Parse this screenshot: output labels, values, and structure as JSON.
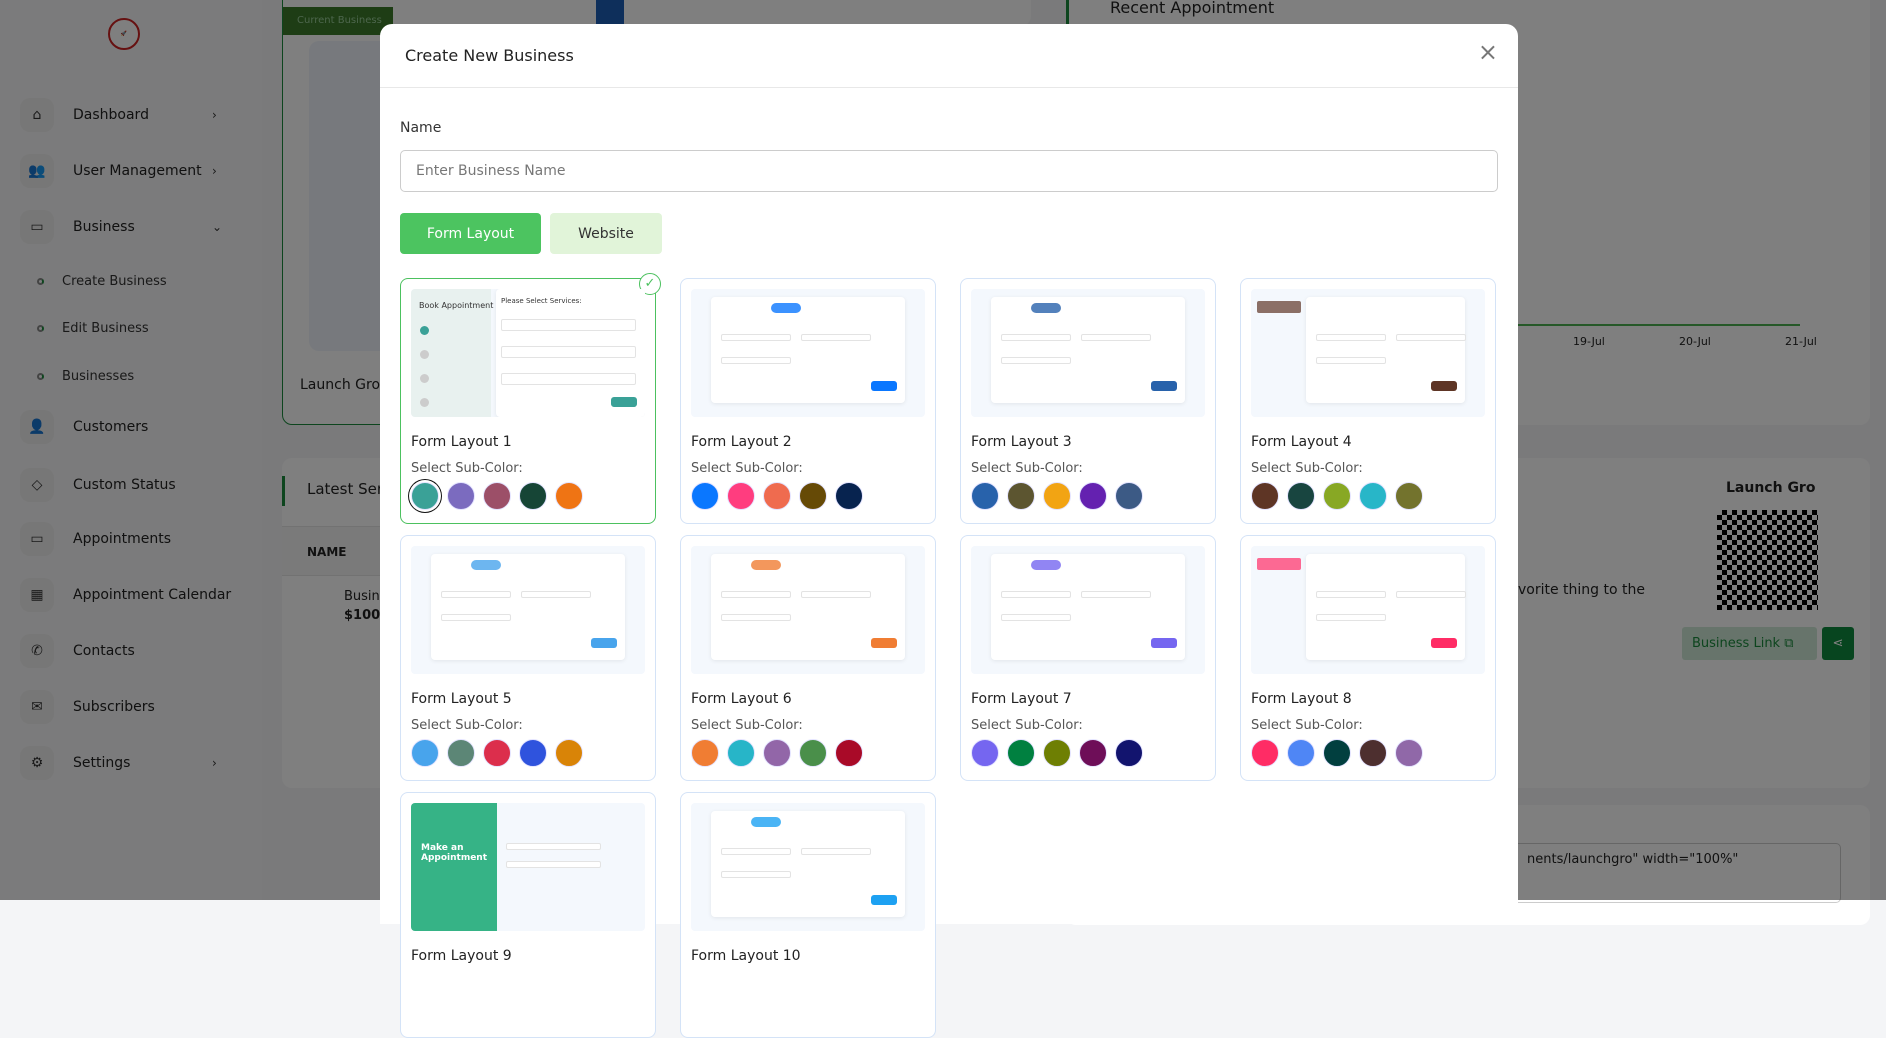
{
  "sidebar": {
    "logo": "LaunchGro",
    "items": [
      {
        "label": "Dashboard",
        "icon": "home-icon",
        "chev": "›"
      },
      {
        "label": "User Management",
        "icon": "users-icon",
        "chev": "›"
      },
      {
        "label": "Business",
        "icon": "card-icon",
        "chev": "⌄"
      },
      {
        "label": "Customers",
        "icon": "user-icon",
        "chev": ""
      },
      {
        "label": "Custom Status",
        "icon": "tag-icon",
        "chev": ""
      },
      {
        "label": "Appointments",
        "icon": "card-icon",
        "chev": ""
      },
      {
        "label": "Appointment Calendar",
        "icon": "calendar-icon",
        "chev": ""
      },
      {
        "label": "Contacts",
        "icon": "phone-icon",
        "chev": ""
      },
      {
        "label": "Subscribers",
        "icon": "mail-icon",
        "chev": ""
      },
      {
        "label": "Settings",
        "icon": "gear-icon",
        "chev": "›"
      }
    ],
    "sub_items": [
      "Create Business",
      "Edit Business",
      "Businesses"
    ]
  },
  "background": {
    "current_business": "Current Business",
    "business_name": "Launch Gro",
    "latest_services": "Latest Ser",
    "name_col": "NAME",
    "service_name": "Busin",
    "service_price": "$100",
    "recent_appointment": "Recent Appointment",
    "chart_dates": [
      "19-Jul",
      "20-Jul",
      "21-Jul"
    ],
    "qr_title": "Launch Gro",
    "description": "vorite thing to the",
    "business_link": "Business Link",
    "embed_code": "nents/launchgro\" width=\"100%\""
  },
  "modal": {
    "title": "Create New Business",
    "close": "×",
    "name_label": "Name",
    "name_placeholder": "Enter Business Name",
    "name_value": "",
    "tabs": [
      {
        "label": "Form Layout",
        "active": true
      },
      {
        "label": "Website",
        "active": false
      }
    ],
    "sub_color_label": "Select Sub-Color:",
    "layouts": [
      {
        "title": "Form Layout 1",
        "selected": true,
        "colors": [
          "#3aa197",
          "#7b6bbf",
          "#9c4f68",
          "#164536",
          "#ef7414"
        ],
        "preview_heading": "Book Appointment",
        "preview_sub": "Please Select Services:"
      },
      {
        "title": "Form Layout 2",
        "colors": [
          "#0a77ff",
          "#ff3d7f",
          "#ef6b4f",
          "#664a06",
          "#07234f"
        ]
      },
      {
        "title": "Form Layout 3",
        "colors": [
          "#2862ab",
          "#5c5530",
          "#f2a413",
          "#6421b0",
          "#3c5a85"
        ]
      },
      {
        "title": "Form Layout 4",
        "colors": [
          "#5e3525",
          "#184540",
          "#88a824",
          "#28b6c8",
          "#73732d"
        ]
      },
      {
        "title": "Form Layout 5",
        "colors": [
          "#48a4ec",
          "#5c8676",
          "#dc2e4c",
          "#2f53dd",
          "#d98407"
        ]
      },
      {
        "title": "Form Layout 6",
        "colors": [
          "#f07d33",
          "#27b5c8",
          "#9266a8",
          "#4a8f4a",
          "#a90a28"
        ]
      },
      {
        "title": "Form Layout 7",
        "colors": [
          "#7566f0",
          "#008040",
          "#6e7f03",
          "#6e0e58",
          "#12146e"
        ]
      },
      {
        "title": "Form Layout 8",
        "colors": [
          "#ff2c65",
          "#4f86f5",
          "#013f3f",
          "#4d2f2f",
          "#9068a8"
        ]
      },
      {
        "title": "Form Layout 9",
        "colors": [],
        "preview_heading": "Make an Appointment"
      },
      {
        "title": "Form Layout 10",
        "colors": []
      }
    ]
  },
  "colors": {
    "primary": "#4cc460",
    "tab_inactive": "#e1f4d9",
    "accent_green": "#1a8a3c"
  }
}
